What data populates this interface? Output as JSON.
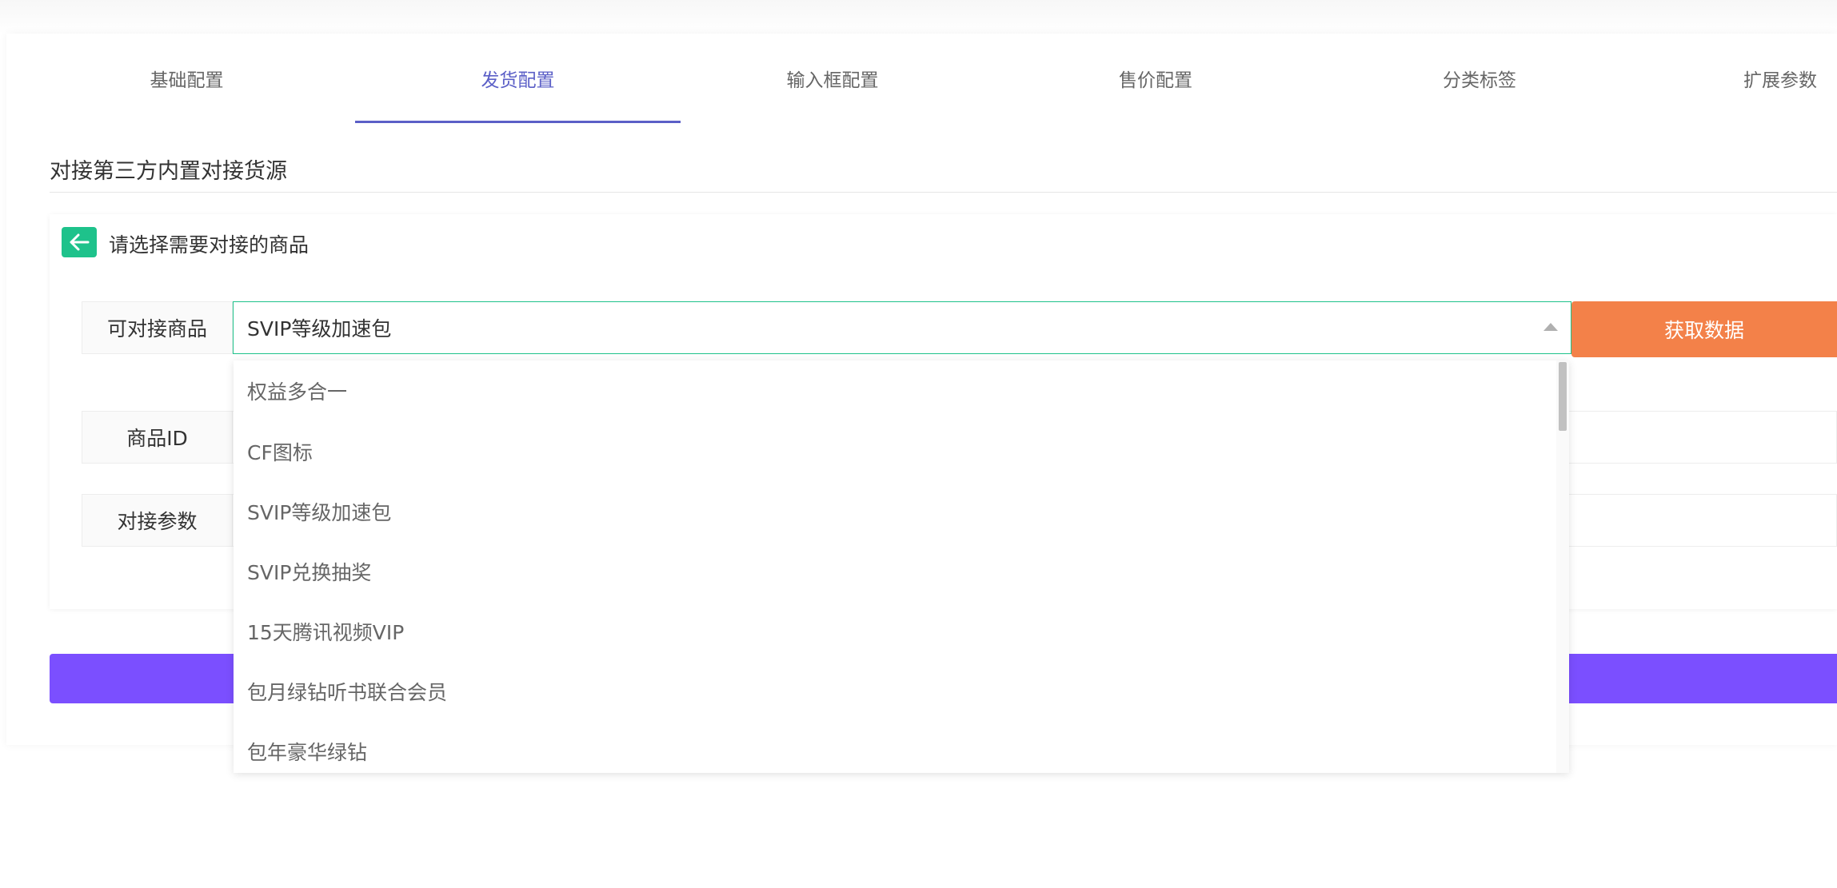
{
  "tabs": [
    {
      "label": "基础配置"
    },
    {
      "label": "发货配置",
      "active": true
    },
    {
      "label": "输入框配置"
    },
    {
      "label": "售价配置"
    },
    {
      "label": "分类标签"
    },
    {
      "label": "扩展参数"
    }
  ],
  "section": {
    "title": "对接第三方内置对接货源"
  },
  "panel": {
    "back_icon": "arrow-left-icon",
    "title": "请选择需要对接的商品",
    "product_label": "可对接商品",
    "selected_product": "SVIP等级加速包",
    "fetch_button": "获取数据",
    "id_label": "商品ID",
    "params_label": "对接参数"
  },
  "dropdown": {
    "options": [
      "权益多合一",
      "CF图标",
      "SVIP等级加速包",
      "SVIP兑换抽奖",
      "15天腾讯视频VIP",
      "包月绿钻听书联合会员",
      "包年豪华绿钻"
    ]
  },
  "colors": {
    "accent": "#5b5fc7",
    "green": "#1ec28b",
    "orange": "#f38149",
    "purple": "#7b4fff"
  }
}
